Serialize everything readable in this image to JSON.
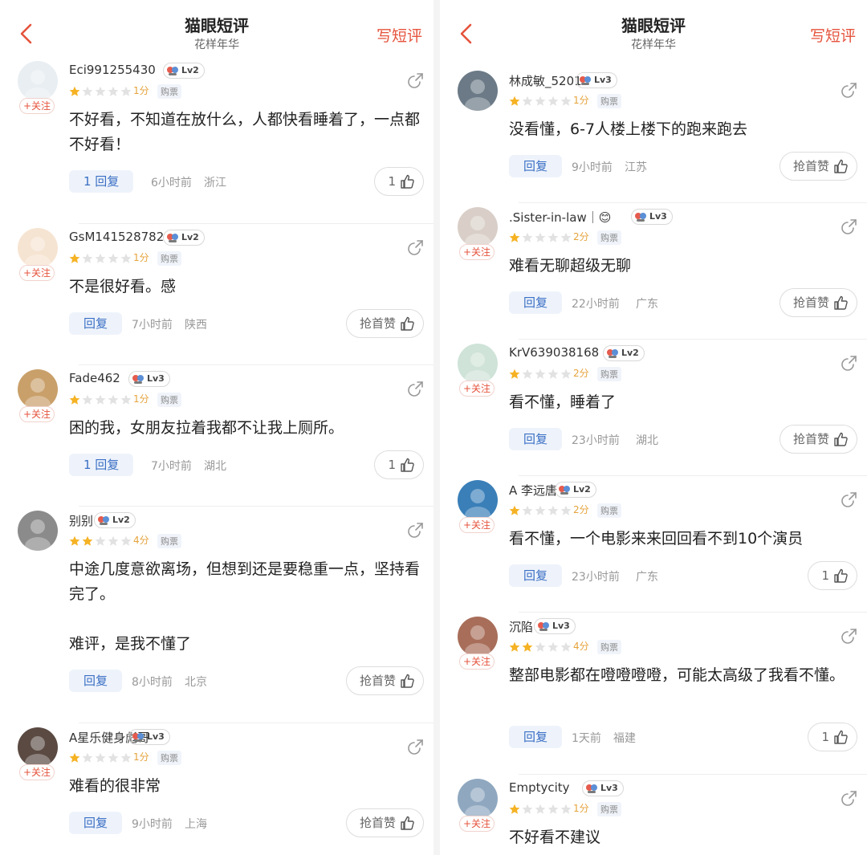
{
  "accent": "#e5533c",
  "left": {
    "title": "猫眼短评",
    "subtitle": "花样年华",
    "write_label": "写短评",
    "reviews": [
      {
        "user": "Eci991255430",
        "level": "Lv2",
        "stars": 1,
        "score": "1分",
        "ticket": "购票",
        "follow": "+关注",
        "text": "不好看，不知道在放什么，人都快看睡着了，一点都不好看！",
        "reply": "1 回复",
        "time": "6小时前",
        "region": "浙江",
        "like": "1",
        "avatar_color": "#e8eef2"
      },
      {
        "user": "GsM141528782",
        "level": "Lv2",
        "stars": 1,
        "score": "1分",
        "ticket": "购票",
        "follow": "+关注",
        "text": "不是很好看。感",
        "reply": "回复",
        "time": "7小时前",
        "region": "陕西",
        "like": "抢首赞",
        "avatar_color": "#f6e4d2"
      },
      {
        "user": "Fade462",
        "level": "Lv3",
        "stars": 1,
        "score": "1分",
        "ticket": "购票",
        "follow": "+关注",
        "text": "困的我，女朋友拉着我都不让我上厕所。",
        "reply": "1 回复",
        "time": "7小时前",
        "region": "湖北",
        "like": "1",
        "avatar_color": "#c9a06a"
      },
      {
        "user": "别别",
        "level": "Lv2",
        "stars": 2,
        "score": "4分",
        "ticket": "购票",
        "follow": "",
        "text": "中途几度意欲离场，但想到还是要稳重一点，坚持看完了。\n\n难评，是我不懂了",
        "reply": "回复",
        "time": "8小时前",
        "region": "北京",
        "like": "抢首赞",
        "avatar_color": "#8b8b8b"
      },
      {
        "user": "A星乐健身彪哥",
        "level": "Lv3",
        "stars": 1,
        "score": "1分",
        "ticket": "购票",
        "follow": "+关注",
        "text": "难看的很非常",
        "reply": "回复",
        "time": "9小时前",
        "region": "上海",
        "like": "抢首赞",
        "avatar_color": "#5a4a42"
      }
    ]
  },
  "right": {
    "title": "猫眼短评",
    "subtitle": "花样年华",
    "write_label": "写短评",
    "reviews": [
      {
        "user": "林成敏_5201",
        "level": "Lv3",
        "stars": 1,
        "score": "1分",
        "ticket": "购票",
        "follow": "",
        "text": "没看懂，6-7人楼上楼下的跑来跑去",
        "reply": "回复",
        "time": "9小时前",
        "region": "江苏",
        "like": "抢首赞",
        "avatar_color": "#6b7a86"
      },
      {
        "user": ".Sister-in-law｜😊",
        "level": "Lv3",
        "stars": 1,
        "score": "2分",
        "ticket": "购票",
        "follow": "+关注",
        "text": "难看无聊超级无聊",
        "reply": "回复",
        "time": "22小时前",
        "region": "广东",
        "like": "抢首赞",
        "avatar_color": "#d9cfc8"
      },
      {
        "user": "KrV639038168",
        "level": "Lv2",
        "stars": 1,
        "score": "2分",
        "ticket": "购票",
        "follow": "+关注",
        "text": "看不懂，睡着了",
        "reply": "回复",
        "time": "23小时前",
        "region": "湖北",
        "like": "抢首赞",
        "avatar_color": "#cfe3d8"
      },
      {
        "user": "A 李远唐",
        "level": "Lv2",
        "stars": 1,
        "score": "2分",
        "ticket": "购票",
        "follow": "+关注",
        "text": "看不懂，一个电影来来回回看不到10个演员",
        "reply": "回复",
        "time": "23小时前",
        "region": "广东",
        "like": "1",
        "avatar_color": "#3a7fb8"
      },
      {
        "user": "沉陷",
        "level": "Lv3",
        "stars": 2,
        "score": "4分",
        "ticket": "购票",
        "follow": "+关注",
        "text": "整部电影都在噔噔噔噔，可能太高级了我看不懂。",
        "reply": "回复",
        "time": "1天前",
        "region": "福建",
        "like": "1",
        "avatar_color": "#a86e5a"
      },
      {
        "user": "Emptycity",
        "level": "Lv3",
        "stars": 1,
        "score": "1分",
        "ticket": "购票",
        "follow": "+关注",
        "text": "不好看不建议",
        "reply": "",
        "time": "",
        "region": "",
        "like": "",
        "avatar_color": "#8fa8c0"
      }
    ]
  }
}
